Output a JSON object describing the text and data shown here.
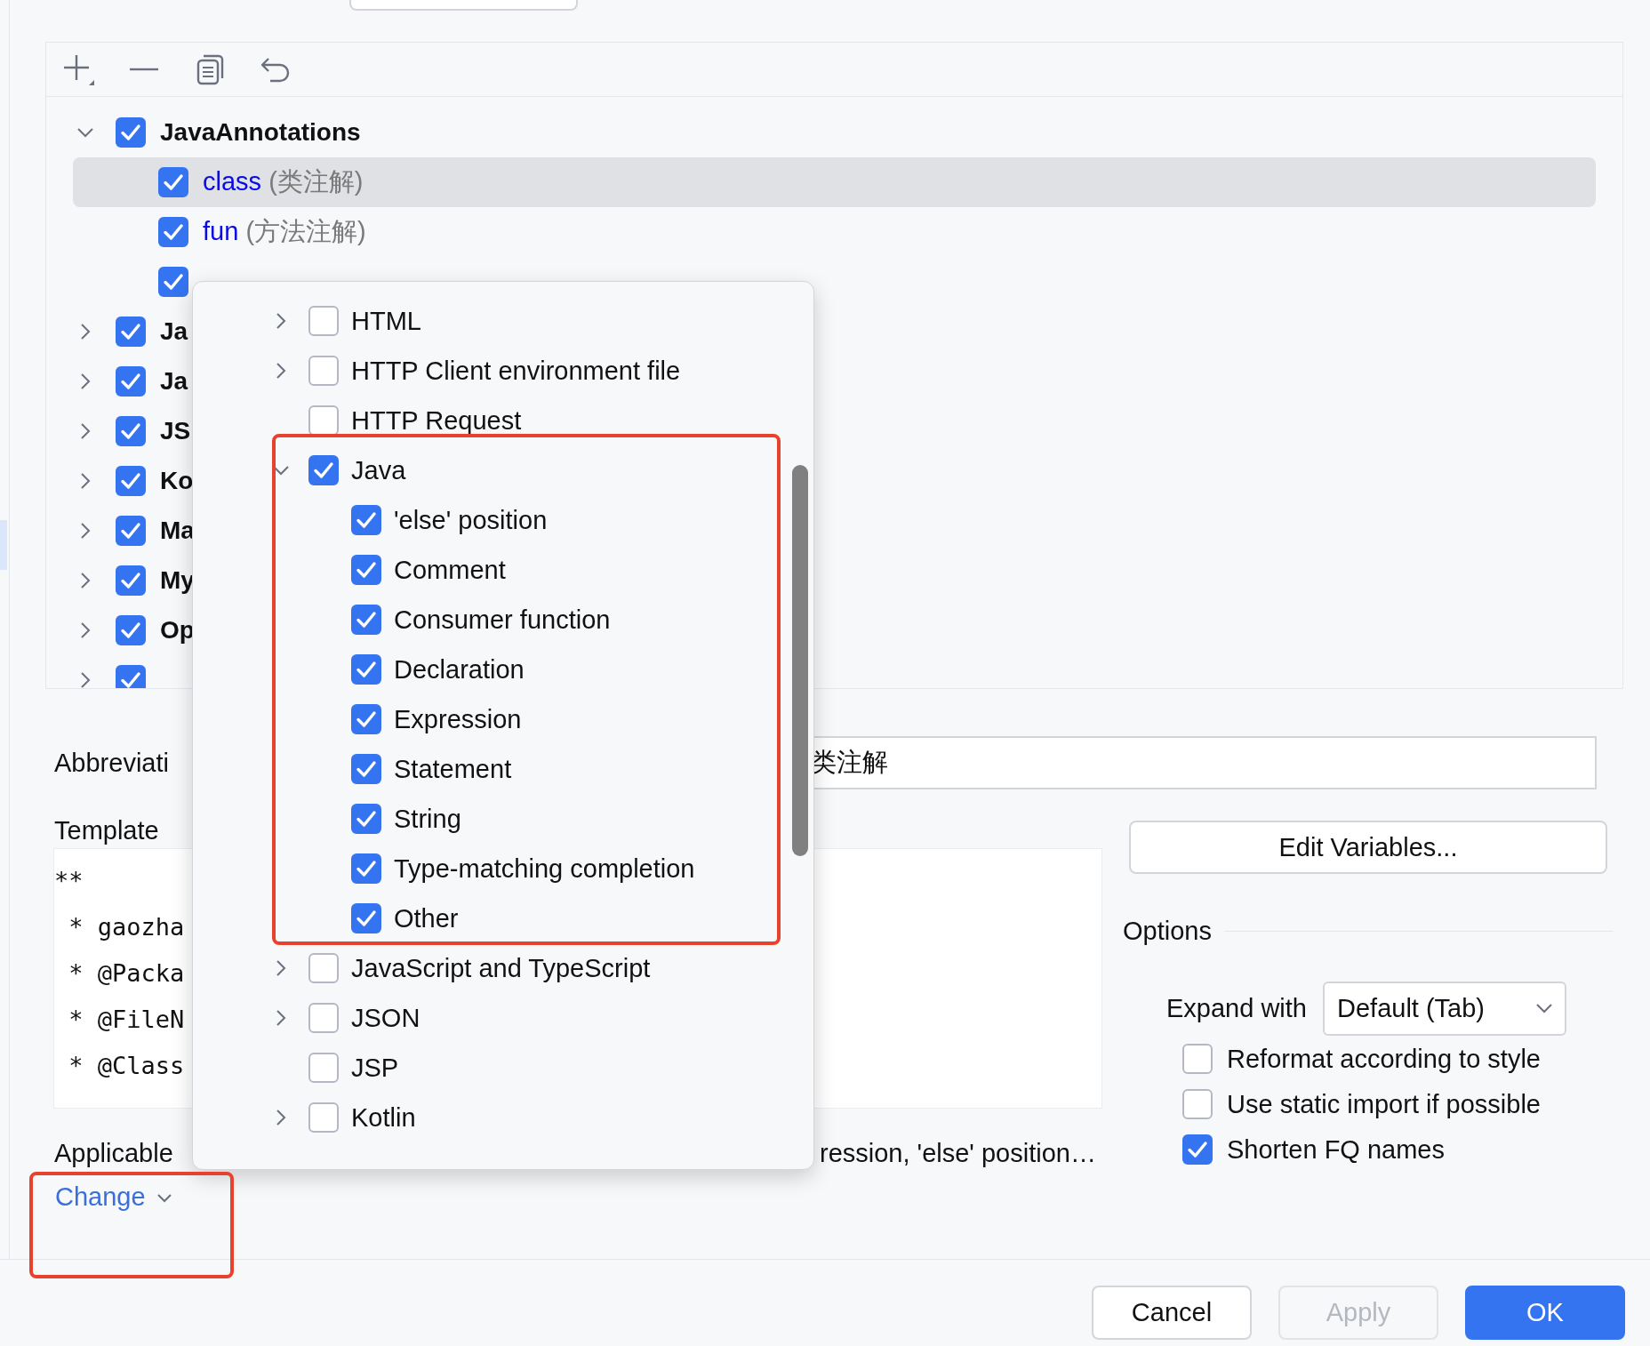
{
  "template_groups": [
    {
      "name": "JavaAnnotations",
      "checked": true,
      "expanded": true,
      "selected": false,
      "children": [
        {
          "name": "class",
          "description": "(类注解)",
          "checked": true,
          "selected": true
        },
        {
          "name": "fun",
          "description": "(方法注解)",
          "checked": true,
          "selected": false
        },
        {
          "checked": true
        }
      ]
    },
    {
      "name": "Ja",
      "checked": true,
      "expanded": false,
      "selected": false
    },
    {
      "name": "Ja",
      "checked": true,
      "expanded": false,
      "selected": false
    },
    {
      "name": "JS",
      "checked": true,
      "expanded": false,
      "selected": false
    },
    {
      "name": "Ko",
      "checked": true,
      "expanded": false,
      "selected": false
    },
    {
      "name": "Ma",
      "checked": true,
      "expanded": false,
      "selected": false
    },
    {
      "name": "My",
      "checked": true,
      "expanded": false,
      "selected": false
    },
    {
      "name": "Op",
      "checked": true,
      "expanded": false,
      "selected": false
    },
    {
      "checked": true,
      "expanded": false
    }
  ],
  "abbreviation": {
    "label": "Abbreviati",
    "value": "类注解"
  },
  "template_text": {
    "label": "Template",
    "lines": [
      "**",
      " * gaozha",
      " * @Packa",
      " * @FileN",
      " * @Class"
    ]
  },
  "applicable": {
    "label": "Applicable",
    "contexts": "ression, 'else' position…",
    "link": "Change"
  },
  "edit_variables_button": "Edit Variables...",
  "options": {
    "title": "Options",
    "expand_with": {
      "label": "Expand with",
      "value": "Default (Tab)"
    },
    "checkboxes": [
      {
        "label": "Reformat according to style",
        "checked": false
      },
      {
        "label": "Use static import if possible",
        "checked": false
      },
      {
        "label": "Shorten FQ names",
        "checked": true
      }
    ]
  },
  "context_popup": {
    "items": [
      {
        "name": "HTML",
        "checked": false,
        "expanded": false
      },
      {
        "name": "HTTP Client environment file",
        "checked": false,
        "expanded": false
      },
      {
        "name": "HTTP Request",
        "checked": false
      },
      {
        "name": "Java",
        "checked": true,
        "expanded": true,
        "children": [
          {
            "name": "'else' position",
            "checked": true
          },
          {
            "name": "Comment",
            "checked": true
          },
          {
            "name": "Consumer function",
            "checked": true
          },
          {
            "name": "Declaration",
            "checked": true
          },
          {
            "name": "Expression",
            "checked": true
          },
          {
            "name": "Statement",
            "checked": true
          },
          {
            "name": "String",
            "checked": true
          },
          {
            "name": "Type-matching completion",
            "checked": true
          },
          {
            "name": "Other",
            "checked": true
          }
        ]
      },
      {
        "name": "JavaScript and TypeScript",
        "checked": false,
        "expanded": false
      },
      {
        "name": "JSON",
        "checked": false,
        "expanded": false
      },
      {
        "name": "JSP",
        "checked": false
      },
      {
        "name": "Kotlin",
        "checked": false,
        "expanded": false
      }
    ]
  },
  "buttons": [
    {
      "label": "Cancel",
      "kind": "default",
      "disabled": false
    },
    {
      "label": "Apply",
      "kind": "default",
      "disabled": true
    },
    {
      "label": "OK",
      "kind": "primary",
      "disabled": false
    }
  ]
}
